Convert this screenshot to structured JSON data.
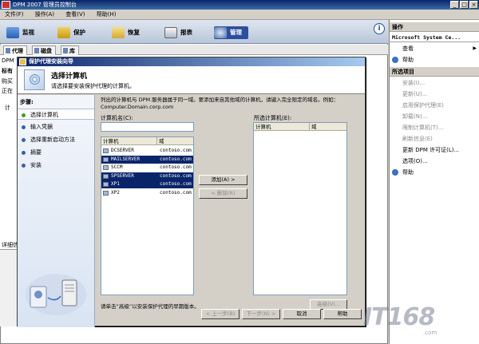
{
  "window": {
    "title": "DPM 2007 管理员控制台"
  },
  "menubar": [
    "文件(F)",
    "操作(A)",
    "查看(V)",
    "帮助(H)"
  ],
  "nav": {
    "items": [
      {
        "name": "monitoring",
        "label": "监视"
      },
      {
        "name": "protection",
        "label": "保护"
      },
      {
        "name": "recovery",
        "label": "恢复"
      },
      {
        "name": "reporting",
        "label": "报表"
      },
      {
        "name": "management",
        "label": "管理"
      }
    ]
  },
  "subtabs": [
    "代理",
    "磁盘",
    "库"
  ],
  "background": {
    "frag1": "DPM",
    "frag2": "标有",
    "frag3": "购买",
    "frag4": "正在",
    "frag5": "计",
    "details": "详细信"
  },
  "actions": {
    "header": "操作",
    "server": "Microsoft System Ce...",
    "view": "查看",
    "help": "帮助",
    "selected_header": "所选项目",
    "items": [
      {
        "label": "安装(I)...",
        "enabled": false
      },
      {
        "label": "更新(U)...",
        "enabled": false
      },
      {
        "label": "启用保护代理(E)",
        "enabled": false
      },
      {
        "label": "卸载(N)...",
        "enabled": false
      },
      {
        "label": "限制计算机(T)...",
        "enabled": false
      },
      {
        "label": "刷新信息(E)",
        "enabled": false
      },
      {
        "label": "更新 DPM 许可证(L)...",
        "enabled": true
      },
      {
        "label": "选项(O)...",
        "enabled": true
      }
    ],
    "help2": "帮助"
  },
  "wizard": {
    "title": "保护代理安装向导",
    "heading": "选择计算机",
    "subheading": "请选择要安装保护代理的计算机。",
    "steps_title": "步骤:",
    "steps": [
      "选择计算机",
      "输入凭据",
      "选择重新启动方法",
      "摘要",
      "安装"
    ],
    "instruction": "列出的计算机与 DPM 服务器属于同一域。要添加来自其他域的计算机，请键入完全限定的域名。例如：Computer.Domain.corp.com",
    "name_label": "计算机名(C):",
    "name_value": "",
    "list_headers": [
      "计算机",
      "域"
    ],
    "computers": [
      {
        "name": "DCSERVER",
        "domain": "contoso.com",
        "selected": false
      },
      {
        "name": "MAILSERVER",
        "domain": "contoso.com",
        "selected": true
      },
      {
        "name": "SCCM",
        "domain": "contoso.com",
        "selected": false
      },
      {
        "name": "SPSERVER",
        "domain": "contoso.com",
        "selected": true
      },
      {
        "name": "XP1",
        "domain": "contoso.com",
        "selected": true
      },
      {
        "name": "XP2",
        "domain": "contoso.com",
        "selected": false
      }
    ],
    "selected_label": "所选计算机(E):",
    "add_button": "添加(A) >",
    "remove_button": "< 删除(R)",
    "advanced_button": "高级(V)...",
    "hint": "请单击“高级”以安装保护代理的早期版本。",
    "back_button": "< 上一步(B)",
    "next_button": "下一步(N) >",
    "cancel_button": "取消",
    "help_button": "帮助"
  },
  "watermark": {
    "text": "IT168",
    "sub": ".com"
  }
}
